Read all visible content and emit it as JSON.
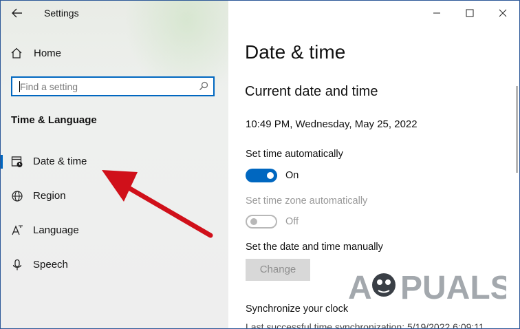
{
  "window": {
    "title": "Settings"
  },
  "sidebar": {
    "home_label": "Home",
    "search_placeholder": "Find a setting",
    "section_title": "Time & Language",
    "items": [
      {
        "label": "Date & time",
        "icon": "calendar-clock-icon",
        "active": true
      },
      {
        "label": "Region",
        "icon": "globe-icon",
        "active": false
      },
      {
        "label": "Language",
        "icon": "language-icon",
        "active": false
      },
      {
        "label": "Speech",
        "icon": "microphone-icon",
        "active": false
      }
    ]
  },
  "window_controls": {
    "minimize": "—",
    "maximize": "☐",
    "close": "✕"
  },
  "main": {
    "title": "Date & time",
    "subtitle": "Current date and time",
    "current_datetime": "10:49 PM, Wednesday, May 25, 2022",
    "set_time_auto": {
      "label": "Set time automatically",
      "state": "On",
      "enabled": true
    },
    "set_timezone_auto": {
      "label": "Set time zone automatically",
      "state": "Off",
      "enabled": false
    },
    "manual": {
      "label": "Set the date and time manually",
      "button": "Change"
    },
    "sync": {
      "label": "Synchronize your clock",
      "last_sync_partial": "Last successful time synchronization: 5/19/2022 6:09:11"
    }
  },
  "watermark": {
    "text": "APPUALS"
  },
  "colors": {
    "accent": "#0067c0",
    "annotation": "#d0101a"
  }
}
